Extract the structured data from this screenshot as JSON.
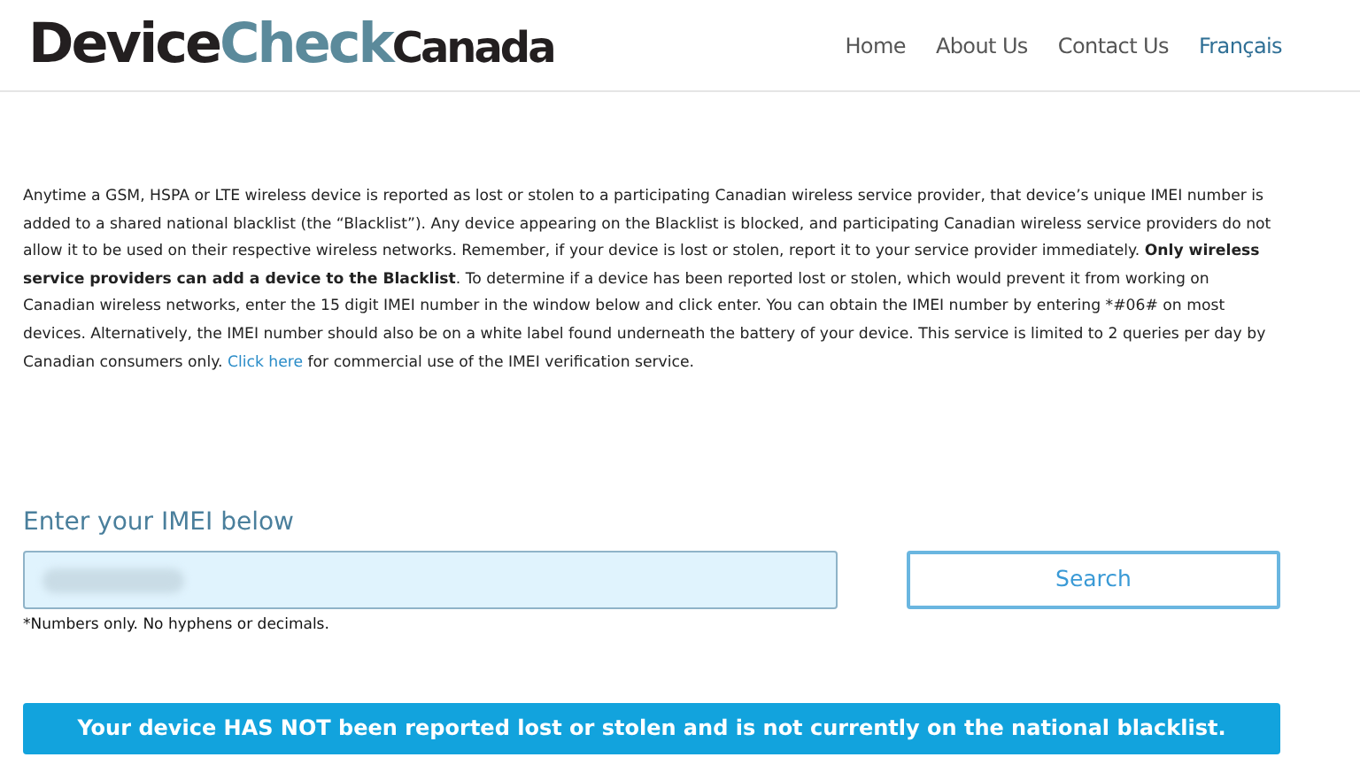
{
  "logo": {
    "parts": [
      {
        "text": "Device",
        "kind": "dark"
      },
      {
        "text": "Check",
        "kind": "accent"
      },
      {
        "text": "Canada",
        "kind": "small"
      }
    ]
  },
  "nav": [
    {
      "label": "Home",
      "kind": "page"
    },
    {
      "label": "About Us",
      "kind": "page"
    },
    {
      "label": "Contact Us",
      "kind": "page"
    },
    {
      "label": "Français",
      "kind": "language"
    }
  ],
  "intro": {
    "before_link": "Anytime a GSM, HSPA or LTE wireless device is reported as lost or stolen to a participating Canadian wireless service provider, that device’s unique IMEI number is added to a shared national blacklist (the “Blacklist”). Any device appearing on the Blacklist is blocked, and participating Canadian wireless service providers do not allow it to be used on their respective wireless networks. Remember, if your device is lost or stolen, report it to your service provider immediately. **Only wireless service providers can add a device to the Blacklist**. To determine if a device has been reported lost or stolen, which would prevent it from working on Canadian wireless networks, enter the 15 digit IMEI number in the window below and click enter. You can obtain the IMEI number by entering *#06# on most devices. Alternatively, the IMEI number should also be on a white label found underneath the battery of your device. This service is limited to 2 queries per day by Canadian consumers only.",
    "link": "Click here",
    "after_link": "for commercial use of the IMEI verification service."
  },
  "form": {
    "heading": "Enter your IMEI below",
    "value_redacted": true,
    "button": "Search",
    "note": "*Numbers only. No hyphens or decimals."
  },
  "result": {
    "message": "Your device HAS NOT been reported lost or stolen and is not currently on the national blacklist."
  }
}
